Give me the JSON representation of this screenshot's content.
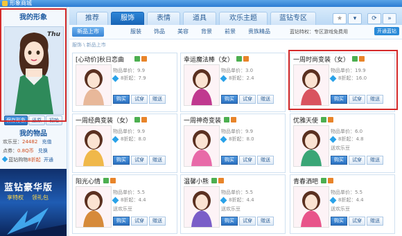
{
  "window": {
    "title": "形象商城"
  },
  "tabs": [
    {
      "label": "推荐"
    },
    {
      "label": "服饰"
    },
    {
      "label": "表情"
    },
    {
      "label": "道具"
    },
    {
      "label": "欢乐主题"
    },
    {
      "label": "蓝钻专区"
    }
  ],
  "active_tab": "服饰",
  "subtabs": [
    {
      "label": "新品上市"
    },
    {
      "label": "服装"
    },
    {
      "label": "饰品"
    },
    {
      "label": "美容"
    },
    {
      "label": "背景"
    },
    {
      "label": "前景"
    },
    {
      "label": "贵族精品"
    }
  ],
  "promo": {
    "text": "蓝钻特权：专区游戏免费用",
    "button": "开通蓝钻"
  },
  "breadcrumb": {
    "path": "服饰 \\ 新品上市"
  },
  "left": {
    "my_image_title": "我的形象",
    "avatar_caption": "Thu",
    "buttons": [
      "保存形象",
      "还原",
      "初始"
    ],
    "my_items_title": "我的物品",
    "stats": [
      {
        "label": "欢乐豆：",
        "value": "24482",
        "action": "充值"
      },
      {
        "label": "点券：",
        "value": "0.8Q币",
        "action": "兑换"
      },
      {
        "label": "蓝钻购物",
        "value": "8折起",
        "action": "开通"
      }
    ],
    "ad": {
      "title": "蓝钻豪华版",
      "l1": "享特权",
      "l2": "领礼包"
    }
  },
  "item_labels": {
    "price": "物品单价：",
    "buy": "购买",
    "try": "试穿",
    "gift": "赠送"
  },
  "items": [
    {
      "name": "[心动价]秋日恋曲",
      "price": "9.9",
      "disc": "8折起：7.9",
      "note": "",
      "color": "#e8b89a"
    },
    {
      "name": "幸运魔法棒（女）",
      "price": "3.0",
      "disc": "8折起：2.4",
      "note": "",
      "color": "#c0398f"
    },
    {
      "name": "一周时尚变装（女）",
      "price": "19.9",
      "disc": "8折起：16.0",
      "note": "",
      "color": "#d9535f"
    },
    {
      "name": "一周经典变装（女）",
      "price": "9.9",
      "disc": "8折起：8.0",
      "note": "",
      "color": "#f0b84a"
    },
    {
      "name": "一周神奇变装",
      "price": "9.9",
      "disc": "8折起：8.0",
      "note": "",
      "color": "#e86aa8"
    },
    {
      "name": "优雅天使",
      "price": "6.0",
      "disc": "8折起：4.8",
      "note": "送欢乐豆",
      "color": "#3aa676"
    },
    {
      "name": "阳光心情",
      "price": "5.5",
      "disc": "8折起：4.4",
      "note": "送欢乐豆",
      "color": "#d68a3a"
    },
    {
      "name": "温馨小熊",
      "price": "5.5",
      "disc": "8折起：4.4",
      "note": "送欢乐豆",
      "color": "#7a5ec8"
    },
    {
      "name": "青春洒吧",
      "price": "5.5",
      "disc": "8折起：4.4",
      "note": "送欢乐豆",
      "color": "#e8548a"
    }
  ]
}
